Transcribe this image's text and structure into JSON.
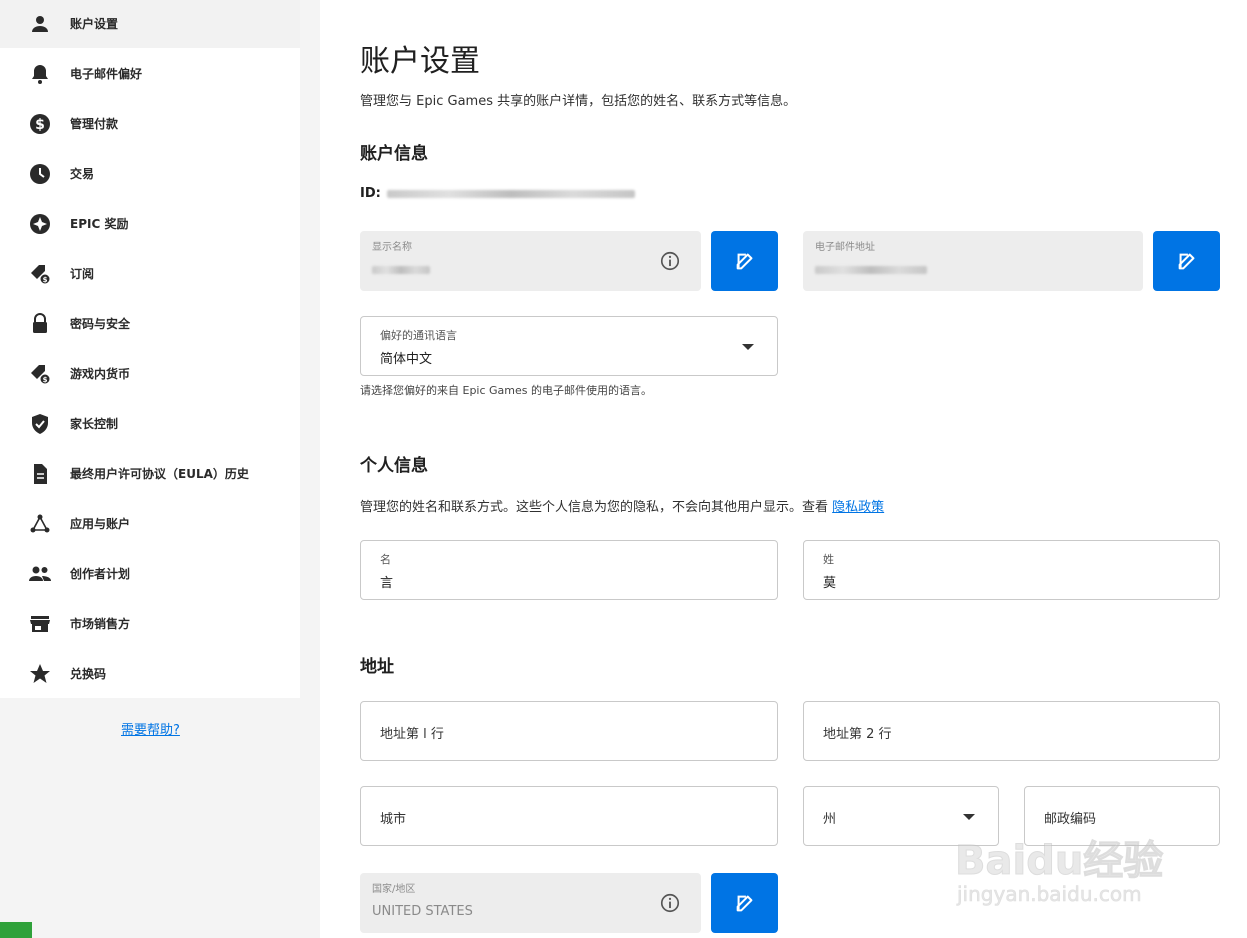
{
  "sidebar": {
    "items": [
      {
        "label": "账户设置",
        "icon": "person-icon"
      },
      {
        "label": "电子邮件偏好",
        "icon": "bell-icon"
      },
      {
        "label": "管理付款",
        "icon": "dollar-icon"
      },
      {
        "label": "交易",
        "icon": "clock-icon"
      },
      {
        "label": "EPIC 奖励",
        "icon": "rewards-icon"
      },
      {
        "label": "订阅",
        "icon": "tag-dollar-icon"
      },
      {
        "label": "密码与安全",
        "icon": "lock-icon"
      },
      {
        "label": "游戏内货币",
        "icon": "currency-tag-icon"
      },
      {
        "label": "家长控制",
        "icon": "shield-check-icon"
      },
      {
        "label": "最终用户许可协议（EULA）历史",
        "icon": "document-icon"
      },
      {
        "label": "应用与账户",
        "icon": "connections-icon"
      },
      {
        "label": "创作者计划",
        "icon": "people-icon"
      },
      {
        "label": "市场销售方",
        "icon": "store-icon"
      },
      {
        "label": "兑换码",
        "icon": "star-icon"
      }
    ],
    "active_index": 0,
    "help_link": "需要帮助?"
  },
  "main": {
    "title": "账户设置",
    "description": "管理您与 Epic Games 共享的账户详情，包括您的姓名、联系方式等信息。",
    "account_info": {
      "heading": "账户信息",
      "id_label": "ID:",
      "display_name": {
        "label": "显示名称"
      },
      "email": {
        "label": "电子邮件地址"
      },
      "language": {
        "label": "偏好的通讯语言",
        "value": "简体中文"
      },
      "language_hint": "请选择您偏好的来自 Epic Games 的电子邮件使用的语言。"
    },
    "personal_info": {
      "heading": "个人信息",
      "description": "管理您的姓名和联系方式。这些个人信息为您的隐私，不会向其他用户显示。查看 ",
      "privacy_link": "隐私政策",
      "first_name": {
        "label": "名",
        "value": "言"
      },
      "last_name": {
        "label": "姓",
        "value": "莫"
      }
    },
    "address": {
      "heading": "地址",
      "line1_placeholder": "地址第 l 行",
      "line2_placeholder": "地址第 2 行",
      "city_placeholder": "城市",
      "state_placeholder": "州",
      "postal_placeholder": "邮政编码",
      "country": {
        "label": "国家/地区",
        "value": "UNITED STATES"
      }
    }
  },
  "watermark": {
    "main": "Baidu经验",
    "sub": "jingyan.baidu.com"
  },
  "colors": {
    "accent": "#0074e4",
    "sidebar_bg": "#f4f4f4",
    "disabled_field": "#ededed",
    "badge": "#2fa13a"
  }
}
